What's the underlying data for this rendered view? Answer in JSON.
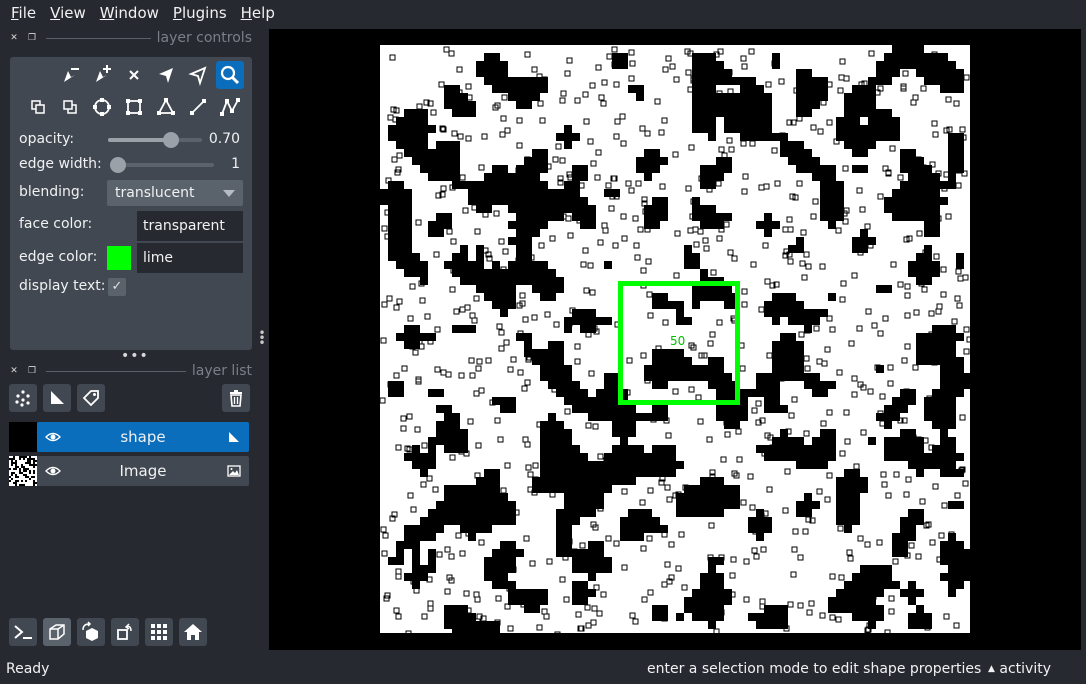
{
  "menu": {
    "file": "File",
    "view": "View",
    "window": "Window",
    "plugins": "Plugins",
    "help": "Help"
  },
  "layer_controls": {
    "title": "layer controls",
    "opacity_label": "opacity:",
    "opacity_value": "0.70",
    "opacity": 0.7,
    "edge_width_label": "edge width:",
    "edge_width_value": "1",
    "blending_label": "blending:",
    "blending_value": "translucent",
    "face_color_label": "face color:",
    "face_color_value": "transparent",
    "edge_color_label": "edge color:",
    "edge_color_value": "lime",
    "edge_color_hex": "#00ff00",
    "display_text_label": "display text:",
    "display_text_checked": true
  },
  "layer_list": {
    "title": "layer list",
    "layers": [
      {
        "name": "shape",
        "selected": true,
        "visible": true,
        "type_icon": "shape-layer-icon"
      },
      {
        "name": "Image",
        "selected": false,
        "visible": true,
        "type_icon": "image-layer-icon"
      }
    ]
  },
  "canvas": {
    "shape_text": "50"
  },
  "status": {
    "left": "Ready",
    "help": "enter a selection mode to edit shape properties",
    "activity": "activity"
  },
  "colors": {
    "accent": "#0a6ebd",
    "panel": "#414851",
    "background": "#262930"
  }
}
